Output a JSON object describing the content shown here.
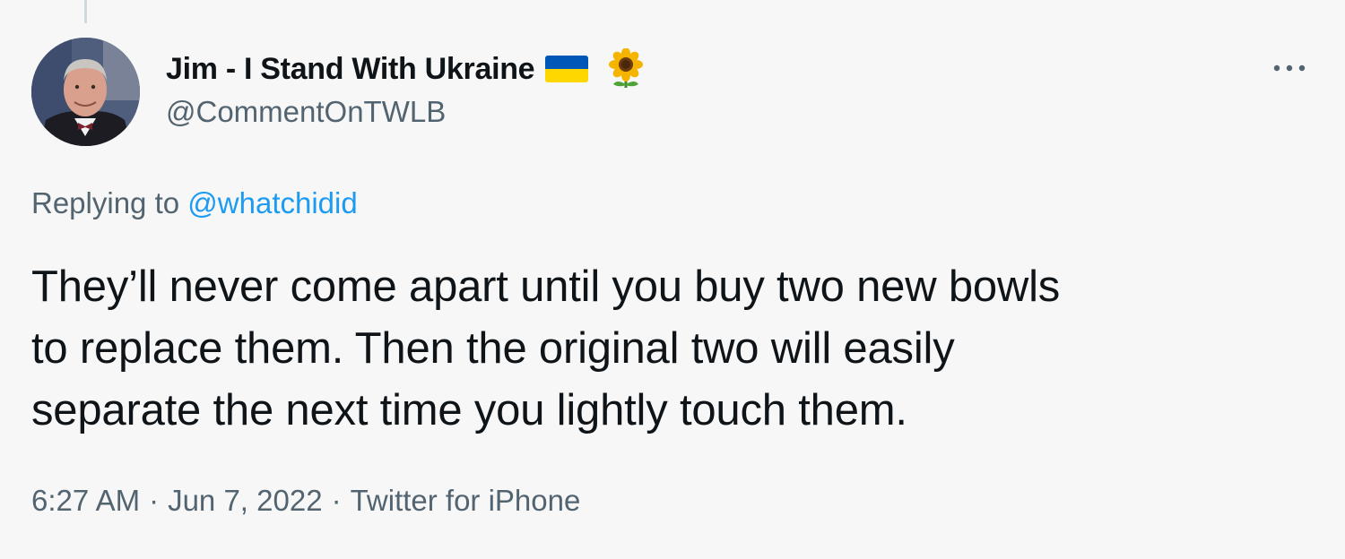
{
  "tweet": {
    "author": {
      "display_name": "Jim - I Stand With Ukraine",
      "handle": "@CommentOnTWLB",
      "badges": [
        "flag-ukraine-icon",
        "sunflower-icon"
      ]
    },
    "more_icon": "more-horizontal-icon",
    "replying_prefix": "Replying to",
    "replying_to": "@whatchidid",
    "text_lines": [
      "They’ll never come apart until you buy two new bowls",
      "to replace them. Then the original two will easily",
      "separate the next time you lightly touch them."
    ],
    "time": "6:27 AM",
    "separator": "·",
    "date": "Jun 7, 2022",
    "source": "Twitter for iPhone"
  },
  "colors": {
    "background": "#f7f7f7",
    "text_primary": "#0f1419",
    "text_secondary": "#536471",
    "link": "#1d9bf0",
    "flag_blue": "#0057b7",
    "flag_yellow": "#ffd700"
  }
}
